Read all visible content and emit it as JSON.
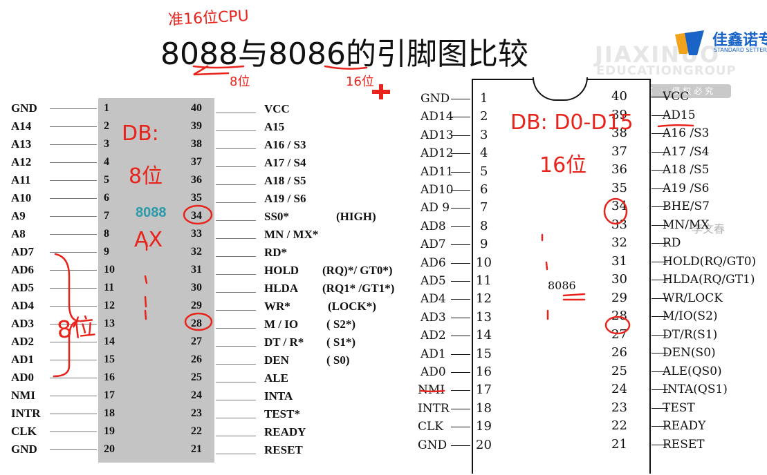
{
  "title": "8088与8086的引脚图比较",
  "logo": {
    "name_cn": "佳鑫诺专",
    "tagline": "STANDARD SETTER IN H",
    "watermark_line1": "JIAXINUO",
    "watermark_line2": "EDUCATIONGROUP",
    "watermark_badge": "版权所属 · 侵权必究"
  },
  "watermark_name": "李文春",
  "chip8088": {
    "name": "8088",
    "left_pins": [
      {
        "num": "1",
        "label": "GND"
      },
      {
        "num": "2",
        "label": "A14"
      },
      {
        "num": "3",
        "label": "A13"
      },
      {
        "num": "4",
        "label": "A12"
      },
      {
        "num": "5",
        "label": "A11"
      },
      {
        "num": "6",
        "label": "A10"
      },
      {
        "num": "7",
        "label": "A9"
      },
      {
        "num": "8",
        "label": "A8"
      },
      {
        "num": "9",
        "label": "AD7"
      },
      {
        "num": "10",
        "label": "AD6"
      },
      {
        "num": "11",
        "label": "AD5"
      },
      {
        "num": "12",
        "label": "AD4"
      },
      {
        "num": "13",
        "label": "AD3"
      },
      {
        "num": "14",
        "label": "AD2"
      },
      {
        "num": "15",
        "label": "AD1"
      },
      {
        "num": "16",
        "label": "AD0"
      },
      {
        "num": "17",
        "label": "NMI"
      },
      {
        "num": "18",
        "label": "INTR"
      },
      {
        "num": "19",
        "label": "CLK"
      },
      {
        "num": "20",
        "label": "GND"
      }
    ],
    "right_pins": [
      {
        "num": "40",
        "label": "VCC",
        "alt": ""
      },
      {
        "num": "39",
        "label": "A15",
        "alt": ""
      },
      {
        "num": "38",
        "label": "A16 / S3",
        "alt": ""
      },
      {
        "num": "37",
        "label": "A17 / S4",
        "alt": ""
      },
      {
        "num": "36",
        "label": "A18 / S5",
        "alt": ""
      },
      {
        "num": "35",
        "label": "A19 / S6",
        "alt": ""
      },
      {
        "num": "34",
        "label": "SS0*",
        "alt": "(HIGH)"
      },
      {
        "num": "33",
        "label": "MN / MX*",
        "alt": ""
      },
      {
        "num": "32",
        "label": "RD*",
        "alt": ""
      },
      {
        "num": "31",
        "label": "HOLD",
        "alt": "(RQ)*/ GT0*)"
      },
      {
        "num": "30",
        "label": "HLDA",
        "alt": "(RQ1* /GT1*)"
      },
      {
        "num": "29",
        "label": "WR*",
        "alt": "(LOCK*)"
      },
      {
        "num": "28",
        "label": "M / IO",
        "alt": "( S2*)"
      },
      {
        "num": "27",
        "label": "DT / R*",
        "alt": "( S1*)"
      },
      {
        "num": "26",
        "label": "DEN",
        "alt": "( S0)"
      },
      {
        "num": "25",
        "label": "ALE",
        "alt": ""
      },
      {
        "num": "24",
        "label": "INTA",
        "alt": ""
      },
      {
        "num": "23",
        "label": "TEST*",
        "alt": ""
      },
      {
        "num": "22",
        "label": "READY",
        "alt": ""
      },
      {
        "num": "21",
        "label": "RESET",
        "alt": ""
      }
    ]
  },
  "chip8086": {
    "name": "8086",
    "left_pins": [
      {
        "num": "1",
        "label": "GND"
      },
      {
        "num": "2",
        "label": "AD14"
      },
      {
        "num": "3",
        "label": "AD13"
      },
      {
        "num": "4",
        "label": "AD12"
      },
      {
        "num": "5",
        "label": "AD11"
      },
      {
        "num": "6",
        "label": "AD10"
      },
      {
        "num": "7",
        "label": "AD 9"
      },
      {
        "num": "8",
        "label": "AD8"
      },
      {
        "num": "9",
        "label": "AD7"
      },
      {
        "num": "10",
        "label": "AD6"
      },
      {
        "num": "11",
        "label": "AD5"
      },
      {
        "num": "12",
        "label": "AD4"
      },
      {
        "num": "13",
        "label": "AD3"
      },
      {
        "num": "14",
        "label": "AD2"
      },
      {
        "num": "15",
        "label": "AD1"
      },
      {
        "num": "16",
        "label": "AD0"
      },
      {
        "num": "17",
        "label": "NMI"
      },
      {
        "num": "18",
        "label": "INTR"
      },
      {
        "num": "19",
        "label": "CLK"
      },
      {
        "num": "20",
        "label": "GND"
      }
    ],
    "right_pins": [
      {
        "num": "40",
        "label": "VCC"
      },
      {
        "num": "39",
        "label": "AD15"
      },
      {
        "num": "38",
        "label": "A16 /S3"
      },
      {
        "num": "37",
        "label": "A17 /S4"
      },
      {
        "num": "36",
        "label": "A18 /S5"
      },
      {
        "num": "35",
        "label": "A19 /S6"
      },
      {
        "num": "34",
        "label": "BHE/S7"
      },
      {
        "num": "33",
        "label": "MN/MX"
      },
      {
        "num": "32",
        "label": "RD"
      },
      {
        "num": "31",
        "label": "HOLD(RQ/GT0)"
      },
      {
        "num": "30",
        "label": "HLDA(RQ/GT1)"
      },
      {
        "num": "29",
        "label": "WR/LOCK"
      },
      {
        "num": "28",
        "label": "M/IO(S2)"
      },
      {
        "num": "27",
        "label": "DT/R(S1)"
      },
      {
        "num": "26",
        "label": "DEN(S0)"
      },
      {
        "num": "25",
        "label": "ALE(QS0)"
      },
      {
        "num": "24",
        "label": "INTA(QS1)"
      },
      {
        "num": "23",
        "label": "TEST"
      },
      {
        "num": "22",
        "label": "READY"
      },
      {
        "num": "21",
        "label": "RESET"
      }
    ]
  },
  "annotations": {
    "color": "#e8231c",
    "top_note": "准16位CPU",
    "bits8_under": "8位",
    "bits16_under": "16位",
    "db_88": "DB:",
    "bits8_88": "8位",
    "ax": "AX",
    "bits8_bracket": "8位",
    "db_86": "DB: D0-D15",
    "bits16_86": "16位"
  }
}
